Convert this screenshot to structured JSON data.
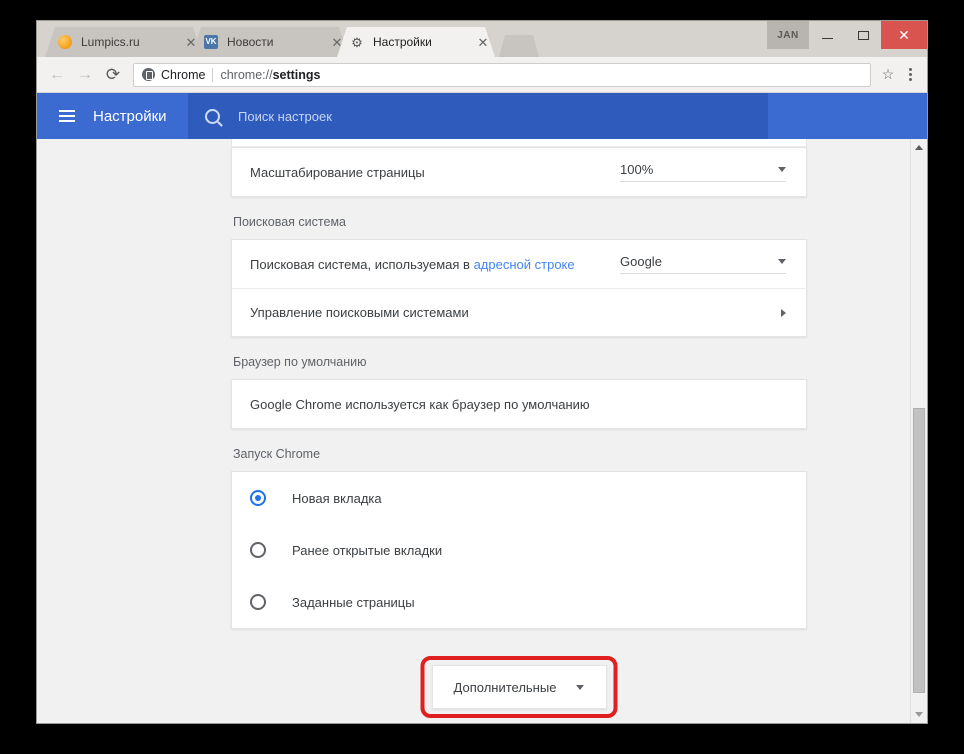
{
  "window": {
    "badge_label": "JAN",
    "minimize_label": "–",
    "maximize_label": "□",
    "close_label": "✕"
  },
  "tabs": [
    {
      "title": "Lumpics.ru",
      "favicon": "orange-circle-icon",
      "close_label": "✕",
      "active": false
    },
    {
      "title": "Новости",
      "favicon": "vk-icon",
      "favicon_text": "VK",
      "close_label": "✕",
      "active": false
    },
    {
      "title": "Настройки",
      "favicon": "gear-icon",
      "favicon_text": "⚙",
      "close_label": "✕",
      "active": true
    }
  ],
  "toolbar": {
    "back_label": "←",
    "forward_label": "→",
    "reload_label": "⟳",
    "omnibox": {
      "secure_icon": "chrome-shield-icon",
      "scheme_label": "Chrome",
      "url_prefix": "chrome://",
      "url_bold": "settings",
      "star_label": "☆"
    },
    "menu_icon": "three-dots-icon"
  },
  "settings_header": {
    "menu_icon": "hamburger-icon",
    "title": "Настройки",
    "search_icon": "search-icon",
    "search_placeholder": "Поиск настроек"
  },
  "content": {
    "appearance_row": {
      "label": "Масштабирование страницы",
      "value": "100%"
    },
    "search_engine": {
      "section_label": "Поисковая система",
      "rows": [
        {
          "label_before": "Поисковая система, используемая в ",
          "label_link": "адресной строке",
          "value": "Google",
          "control": "dropdown"
        },
        {
          "label_before": "Управление поисковыми системами",
          "label_link": "",
          "value": "",
          "control": "arrow"
        }
      ]
    },
    "default_browser": {
      "section_label": "Браузер по умолчанию",
      "status_text": "Google Chrome используется как браузер по умолчанию"
    },
    "startup": {
      "section_label": "Запуск Chrome",
      "options": [
        {
          "label": "Новая вкладка",
          "selected": true
        },
        {
          "label": "Ранее открытые вкладки",
          "selected": false
        },
        {
          "label": "Заданные страницы",
          "selected": false
        }
      ]
    },
    "advanced": {
      "label": "Дополнительные",
      "chevron_icon": "chevron-down-icon",
      "highlight_color": "#e02020"
    }
  },
  "scrollbar": {
    "up_icon": "scroll-up-arrow-icon",
    "down_icon": "scroll-down-arrow-icon"
  }
}
